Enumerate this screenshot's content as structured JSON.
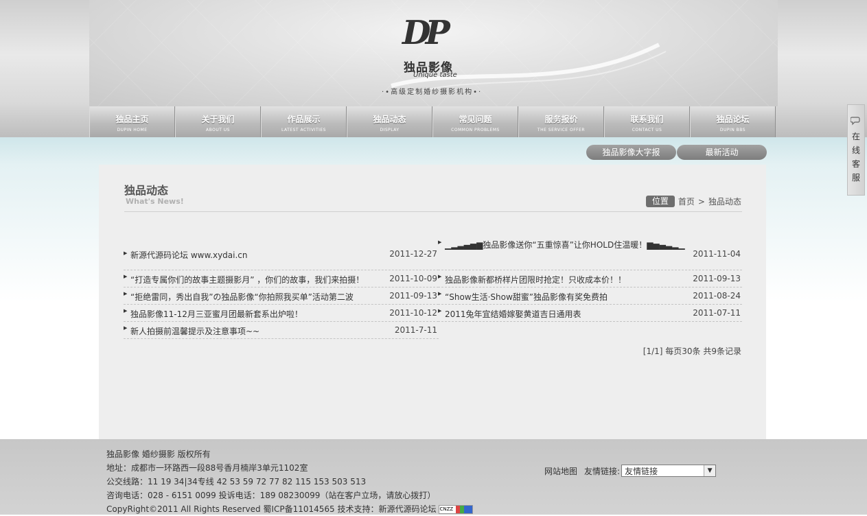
{
  "logo": {
    "mark": "DP",
    "name_cn": "独品影像",
    "name_en": "Unique taste",
    "tagline": "·•高级定制婚纱摄影机构•·"
  },
  "nav": [
    {
      "cn": "独品主页",
      "en": "DUPIN HOME"
    },
    {
      "cn": "关于我们",
      "en": "ABOUT US"
    },
    {
      "cn": "作品展示",
      "en": "LATEST ACTIVITIES"
    },
    {
      "cn": "独品动态",
      "en": "DISPLAY"
    },
    {
      "cn": "常见问题",
      "en": "COMMON PROBLEMS"
    },
    {
      "cn": "服务报价",
      "en": "THE SERVICE OFFER"
    },
    {
      "cn": "联系我们",
      "en": "CONTACT US"
    },
    {
      "cn": "独品论坛",
      "en": "DUPIN BBS"
    }
  ],
  "pills": {
    "left": "独品影像大字报",
    "right": "最新活动"
  },
  "section": {
    "title": "独品动态",
    "subtitle": "What's News!"
  },
  "breadcrumb": {
    "tag": "位置",
    "home": "首页",
    "sep": ">",
    "current": "独品动态"
  },
  "news_left": [
    {
      "title": "新源代源码论坛 www.xydai.cn",
      "date": "2011-12-27"
    },
    {
      "title": "“打造专属你们的故事主题摄影月” ，你们的故事，我们来拍摄！",
      "date": "2011-10-09"
    },
    {
      "title": "“拒绝雷同，秀出自我”の独品影像“你拍照我买单”活动第二波",
      "date": "2011-09-13"
    },
    {
      "title": "独品影像11-12月三亚蜜月团最新套系出炉啦！",
      "date": "2011-10-12"
    },
    {
      "title": "新人拍摄前温馨提示及注意事项~~",
      "date": "2011-7-11"
    }
  ],
  "news_right": [
    {
      "title": "▁▂▃▄▅▆独品影像送你“五重惊喜”让你HOLD住温暖！▆▅▄▃▂▁",
      "date": "2011-11-04"
    },
    {
      "title": "独品影像新都桥样片团限时抢定！只收成本价！！",
      "date": "2011-09-13"
    },
    {
      "title": "“Show生活·Show甜蜜”独品影像有奖免费拍",
      "date": "2011-08-24"
    },
    {
      "title": "2011兔年宜结婚嫁娶黄道吉日通用表",
      "date": "2011-07-11"
    }
  ],
  "pager": "[1/1] 每页30条 共9条记录",
  "footer": {
    "line1": "独品影像 婚纱摄影 版权所有",
    "line2": "地址：成都市一环路西一段88号香月楠岸3单元1102室",
    "line3": "公交线路：11 19 34|34专线 42 53 59 72 77 82 115 153 503 513",
    "line4": "咨询电话：028 - 6151 0099 投诉电话：189 08230099（站在客户立场，请放心拨打）",
    "line5": "CopyRight©2011 All Rights Reserved 蜀ICP备11014565 技术支持：新源代源码论坛",
    "cnzz": "CNZZ",
    "sitemap": "网站地图",
    "links_label": "友情链接:",
    "links_selected": "友情链接"
  },
  "side_widget": {
    "icon": "chat-icon",
    "text": [
      "在",
      "线",
      "客",
      "服"
    ]
  }
}
